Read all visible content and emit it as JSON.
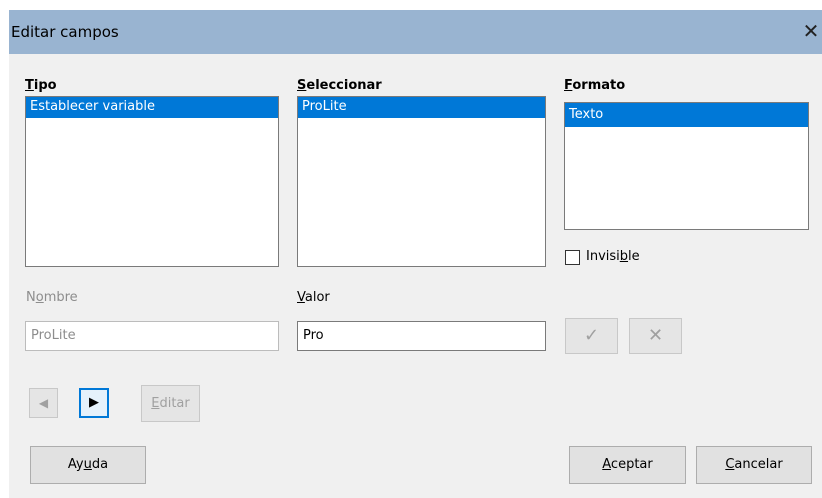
{
  "dialog": {
    "title": "Editar campos",
    "close_glyph": "✕"
  },
  "tipo": {
    "label_underlined": "T",
    "label_rest": "ipo",
    "items": [
      "Establecer variable"
    ]
  },
  "seleccionar": {
    "label_underlined": "S",
    "label_rest": "eleccionar",
    "items": [
      "ProLite"
    ]
  },
  "formato": {
    "label_underlined": "F",
    "label_rest": "ormato",
    "items": [
      "Texto"
    ]
  },
  "invisible": {
    "label_pre": "Invisi",
    "label_underlined": "b",
    "label_post": "le",
    "checked": false
  },
  "nombre": {
    "label_pre": "N",
    "label_underlined": "o",
    "label_post": "mbre",
    "value": "ProLite"
  },
  "valor": {
    "label_underlined": "V",
    "label_rest": "alor",
    "value": "Pro"
  },
  "apply_glyph": "✓",
  "clear_glyph": "✕",
  "nav": {
    "prev_glyph": "◀",
    "next_glyph": "▶"
  },
  "editar_button": {
    "label_underlined": "E",
    "label_rest": "ditar"
  },
  "ayuda_button": {
    "label_pre": "Ay",
    "label_underlined": "u",
    "label_post": "da"
  },
  "aceptar_button": {
    "label_underlined": "A",
    "label_rest": "ceptar"
  },
  "cancelar_button": {
    "label_underlined": "C",
    "label_rest": "ancelar"
  },
  "colors": {
    "titlebar": "#99b4d1",
    "selection": "#0078d7",
    "body": "#f0f0f0",
    "focus": "#0078d7"
  }
}
